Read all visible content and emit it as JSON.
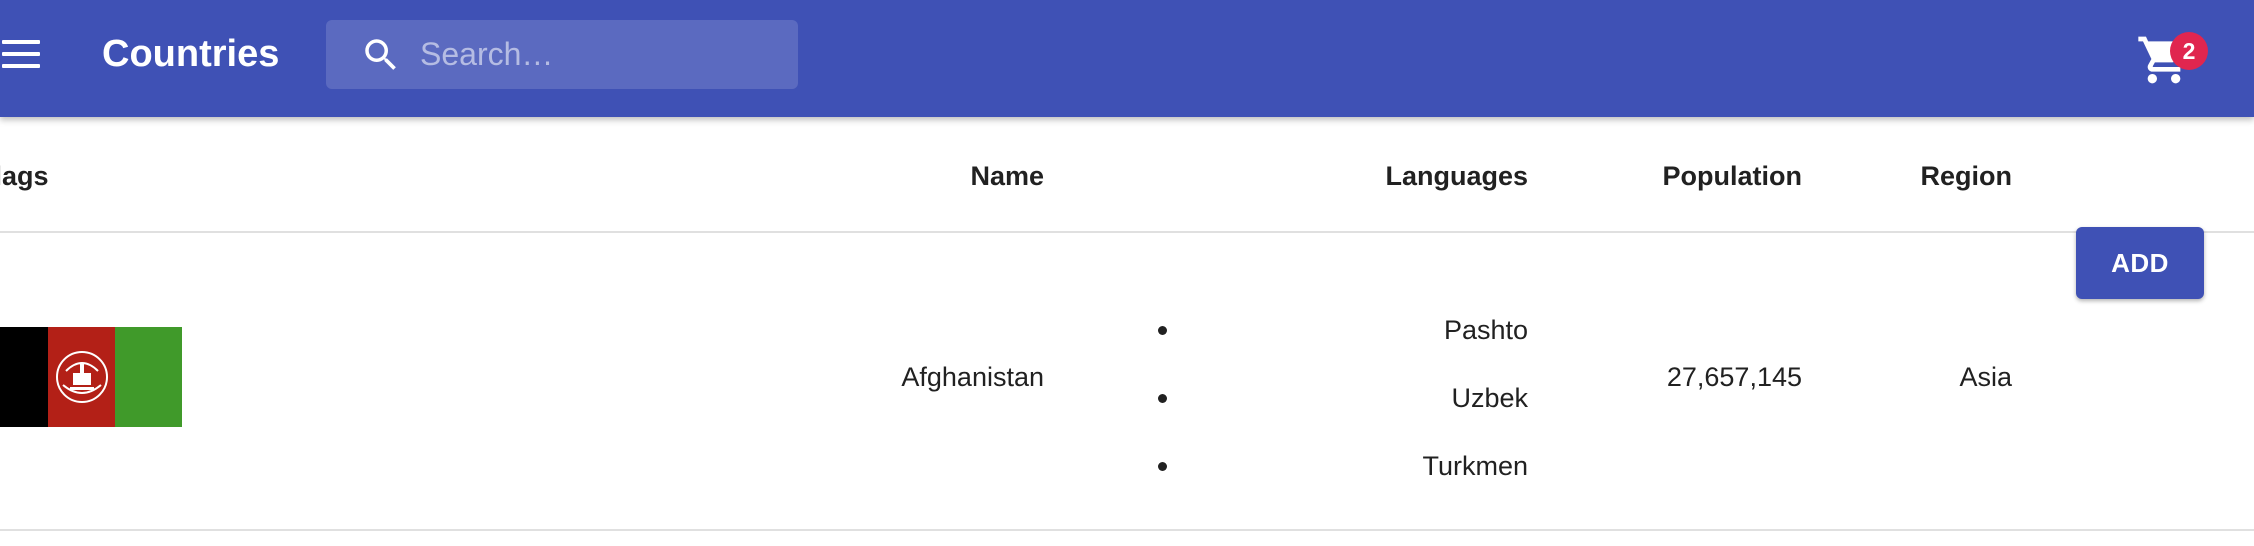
{
  "appbar": {
    "title": "Countries",
    "search": {
      "placeholder": "Search…",
      "value": ""
    },
    "cart": {
      "badge_count": "2"
    },
    "colors": {
      "background": "#3f51b5",
      "badge": "#e0264f"
    }
  },
  "table": {
    "headers": {
      "flags": "Flags",
      "name": "Name",
      "languages": "Languages",
      "population": "Population",
      "region": "Region"
    },
    "rows": [
      {
        "flag_icon": "afghanistan-flag",
        "flag_colors": [
          "#000000",
          "#b32017",
          "#409a2a"
        ],
        "name": "Afghanistan",
        "languages": [
          "Pashto",
          "Uzbek",
          "Turkmen"
        ],
        "population": "27,657,145",
        "region": "Asia",
        "action_label": "ADD"
      }
    ]
  },
  "icons": {
    "menu": "menu-icon",
    "search": "search-icon",
    "cart": "shopping-cart-icon"
  }
}
